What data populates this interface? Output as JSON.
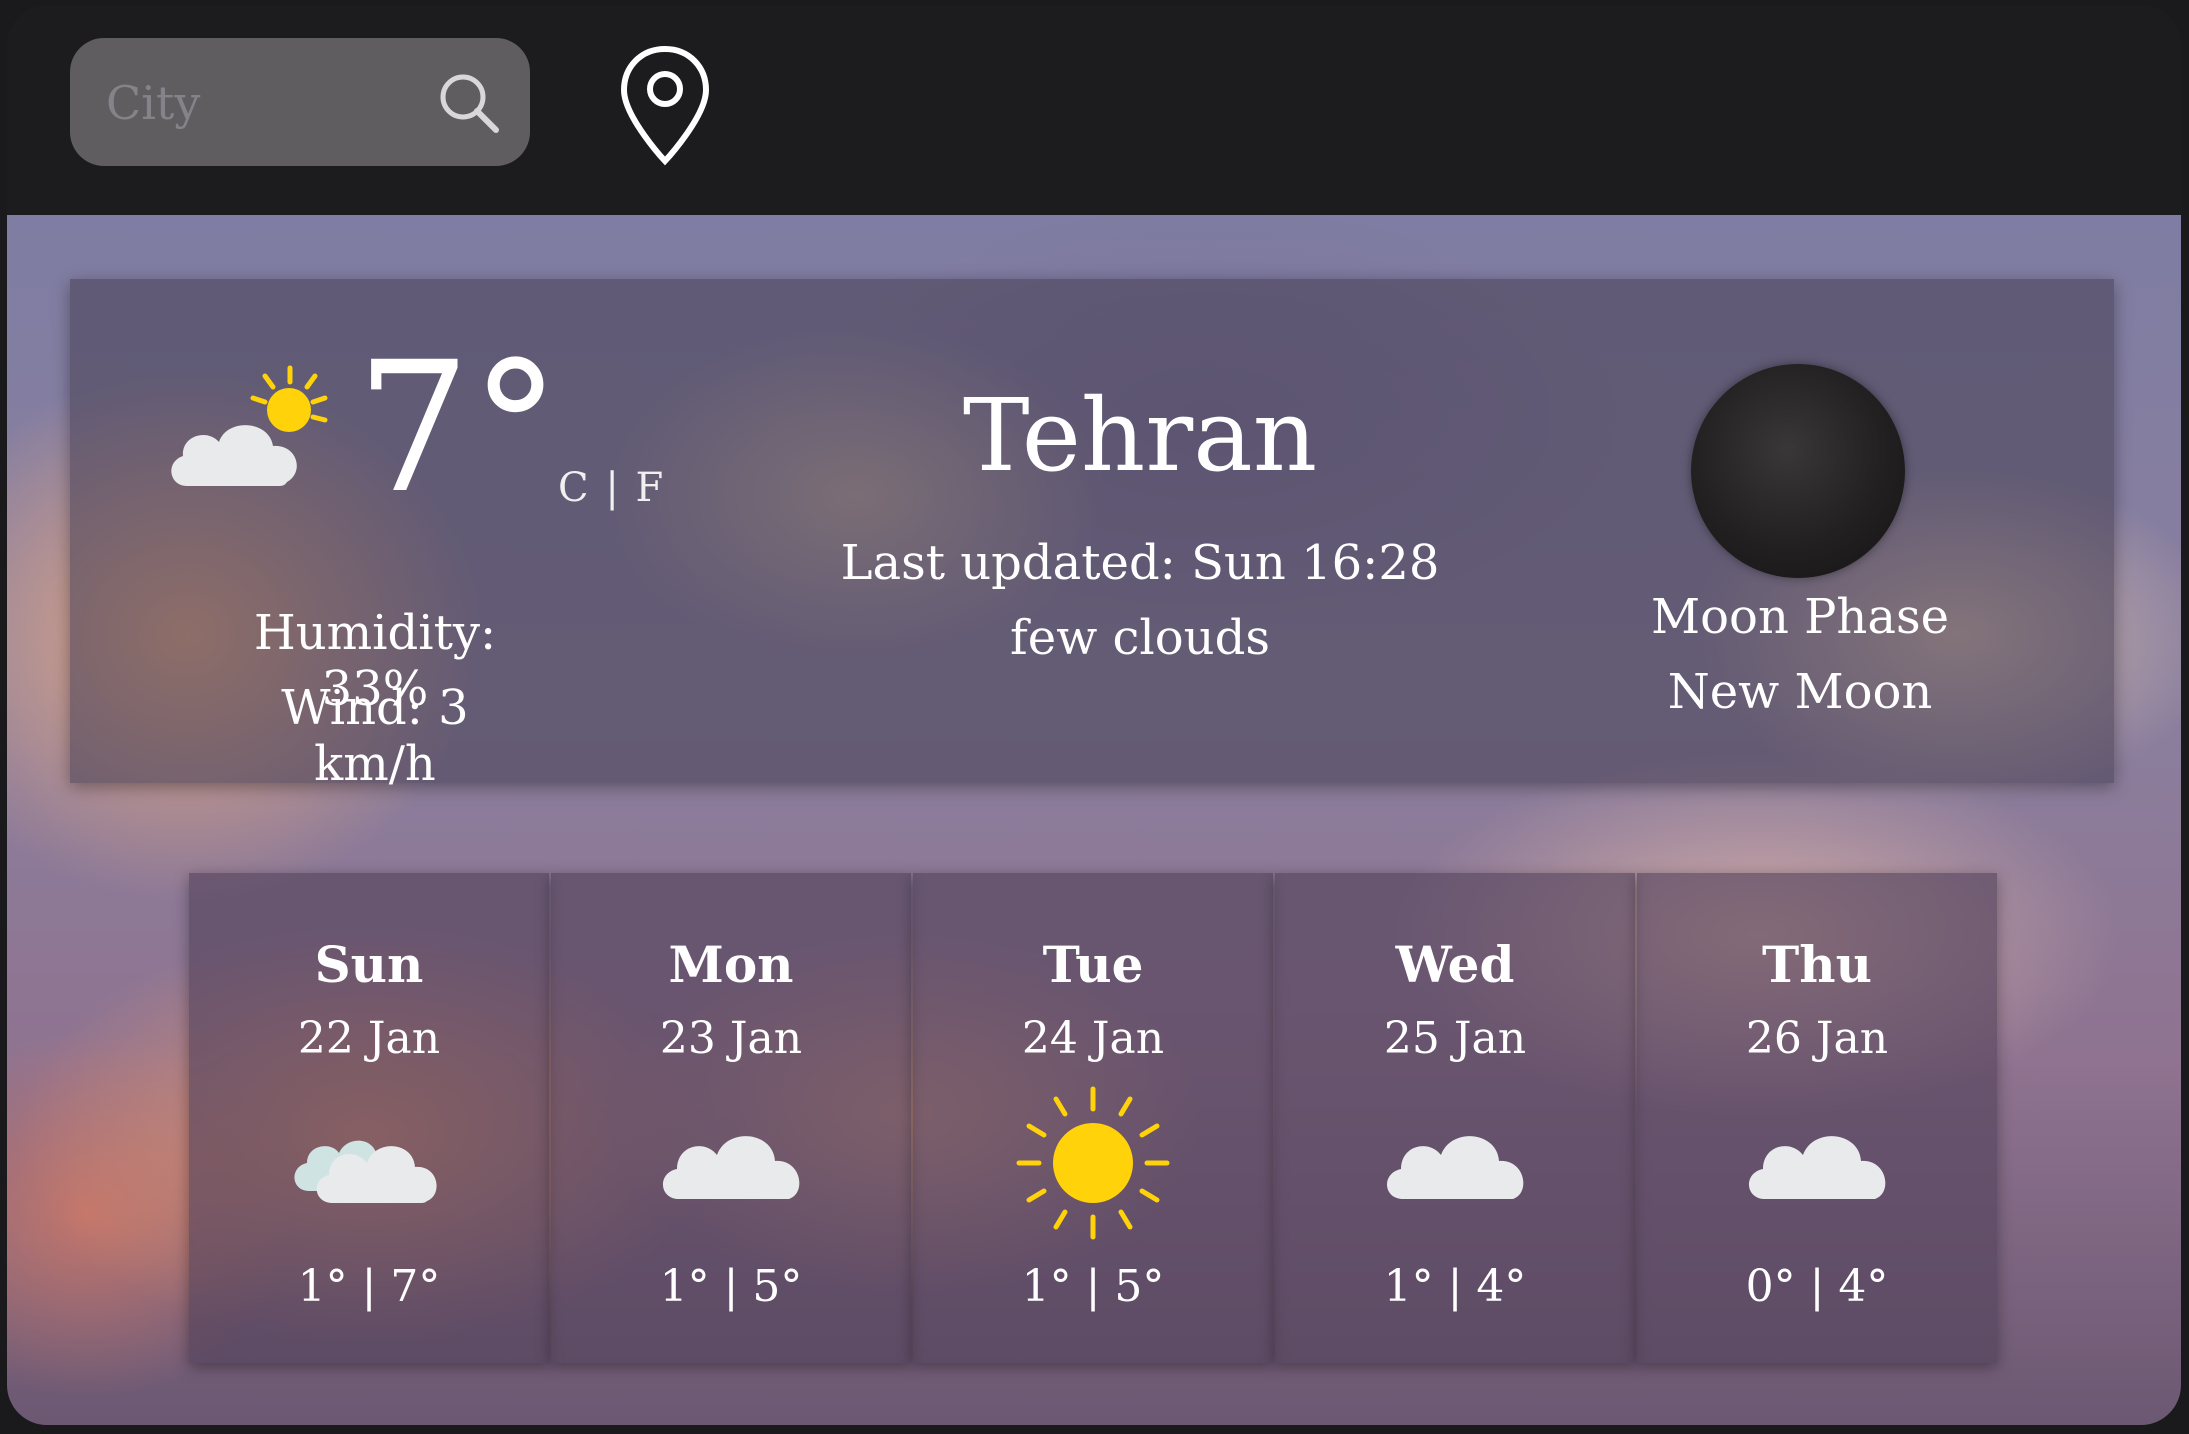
{
  "search": {
    "placeholder": "City"
  },
  "current": {
    "temperature": "7°",
    "units": "C | F",
    "humidity": "Humidity: 33%",
    "wind": "Wind: 3 km/h",
    "city": "Tehran",
    "last_updated": "Last updated: Sun 16:28",
    "description": "few clouds",
    "moon_label": "Moon Phase",
    "moon_value": "New Moon",
    "icon": "partly-sunny-icon"
  },
  "forecast": [
    {
      "day": "Sun",
      "date": "22 Jan",
      "temps": "1° | 7°",
      "icon": "clouds-icon"
    },
    {
      "day": "Mon",
      "date": "23 Jan",
      "temps": "1° | 5°",
      "icon": "cloud-icon"
    },
    {
      "day": "Tue",
      "date": "24 Jan",
      "temps": "1° | 5°",
      "icon": "sun-icon"
    },
    {
      "day": "Wed",
      "date": "25 Jan",
      "temps": "1° | 4°",
      "icon": "cloud-icon"
    },
    {
      "day": "Thu",
      "date": "26 Jan",
      "temps": "0° | 4°",
      "icon": "cloud-icon"
    }
  ],
  "colors": {
    "sun": "#FFD20A",
    "cloud": "#E8EAEC",
    "topbar": "#1C1B1D"
  }
}
